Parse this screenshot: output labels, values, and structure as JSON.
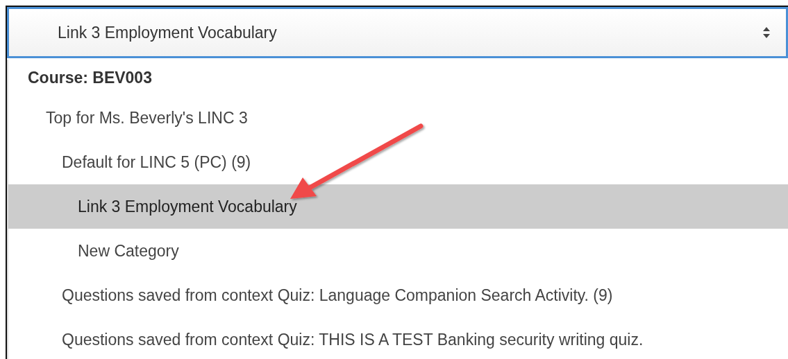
{
  "select": {
    "value": "Link 3 Employment Vocabulary"
  },
  "group": {
    "label": "Course: BEV003"
  },
  "options": [
    {
      "label": "Top for Ms. Beverly's LINC 3",
      "selected": false,
      "children": [
        {
          "label": "Default for LINC 5 (PC) (9)",
          "selected": false,
          "children": [
            {
              "label": "Link 3 Employment Vocabulary",
              "selected": true
            },
            {
              "label": "New Category",
              "selected": false
            }
          ]
        },
        {
          "label": "Questions saved from context Quiz: Language Companion Search Activity. (9)",
          "selected": false
        },
        {
          "label": "Questions saved from context Quiz: THIS IS A TEST Banking security writing quiz.",
          "selected": false
        }
      ]
    }
  ]
}
